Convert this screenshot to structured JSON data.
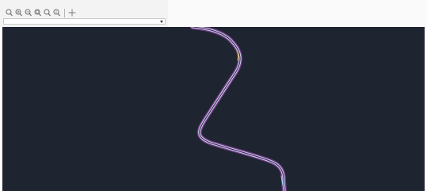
{
  "toolbar": {
    "buttons": [
      {
        "name": "zoom-window-button",
        "icon": "zoom-window-icon"
      },
      {
        "name": "zoom-in-button",
        "icon": "zoom-in-icon"
      },
      {
        "name": "zoom-out-button",
        "icon": "zoom-out-icon"
      },
      {
        "name": "zoom-extents-button",
        "icon": "zoom-extents-icon"
      },
      {
        "name": "zoom-previous-button",
        "icon": "zoom-previous-icon"
      },
      {
        "name": "zoom-realtime-button",
        "icon": "zoom-realtime-icon"
      },
      {
        "name": "pan-button",
        "icon": "pan-crosshair-icon"
      }
    ]
  },
  "layer_select": {
    "value": ""
  },
  "colors": {
    "toolbar_bg": "#f3f3f3",
    "viewport_bg": "#1f2530",
    "road_outer": "#6e3a85",
    "road_inner": "#c8c8e8",
    "road_accent": "#d9a032"
  }
}
